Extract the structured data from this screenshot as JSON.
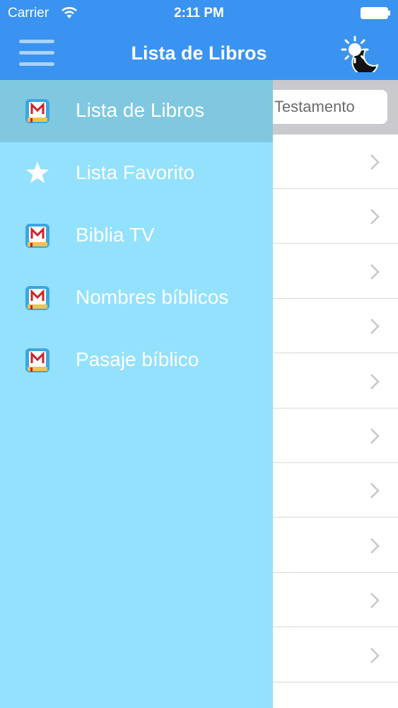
{
  "status_bar": {
    "carrier": "Carrier",
    "time": "2:11 PM"
  },
  "header": {
    "title": "Lista de Libros"
  },
  "segment": {
    "label": "o Testamento"
  },
  "drawer": {
    "items": [
      {
        "label": "Lista de Libros",
        "icon": "bible-app-icon",
        "active": true
      },
      {
        "label": "Lista Favorito",
        "icon": "star-icon",
        "active": false
      },
      {
        "label": "Biblia TV",
        "icon": "bible-app-icon",
        "active": false
      },
      {
        "label": "Nombres bíblicos",
        "icon": "bible-app-icon",
        "active": false
      },
      {
        "label": "Pasaje bíblico",
        "icon": "bible-app-icon",
        "active": false
      }
    ]
  },
  "list": {
    "row_count": 10
  },
  "colors": {
    "header": "#3a93f0",
    "drawer": "#93e1fd",
    "drawer_active": "#7fc8e0",
    "segment_bar": "#c9c9ce"
  }
}
